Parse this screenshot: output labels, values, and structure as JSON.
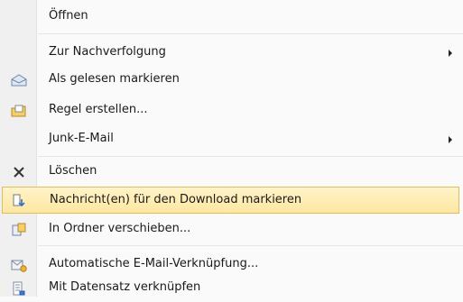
{
  "menu": {
    "items": [
      {
        "label": "Öffnen"
      },
      {
        "label": "Zur Nachverfolgung"
      },
      {
        "label": "Als gelesen markieren",
        "icon": "envelope-open-icon"
      },
      {
        "label": "Regel erstellen...",
        "icon": "folder-rule-icon"
      },
      {
        "label": "Junk-E-Mail"
      },
      {
        "label": "Löschen",
        "icon": "delete-x-icon"
      },
      {
        "label": "Nachricht(en) für den Download markieren",
        "icon": "download-mark-icon"
      },
      {
        "label": "In Ordner verschieben...",
        "icon": "move-to-folder-icon"
      },
      {
        "label": "Automatische E-Mail-Verknüpfung...",
        "icon": "auto-link-icon"
      },
      {
        "label": "Mit Datensatz verknüpfen",
        "icon": "link-record-icon"
      }
    ]
  },
  "colors": {
    "highlight_fill": "#fde7a0",
    "highlight_border": "#e0bd5d"
  }
}
